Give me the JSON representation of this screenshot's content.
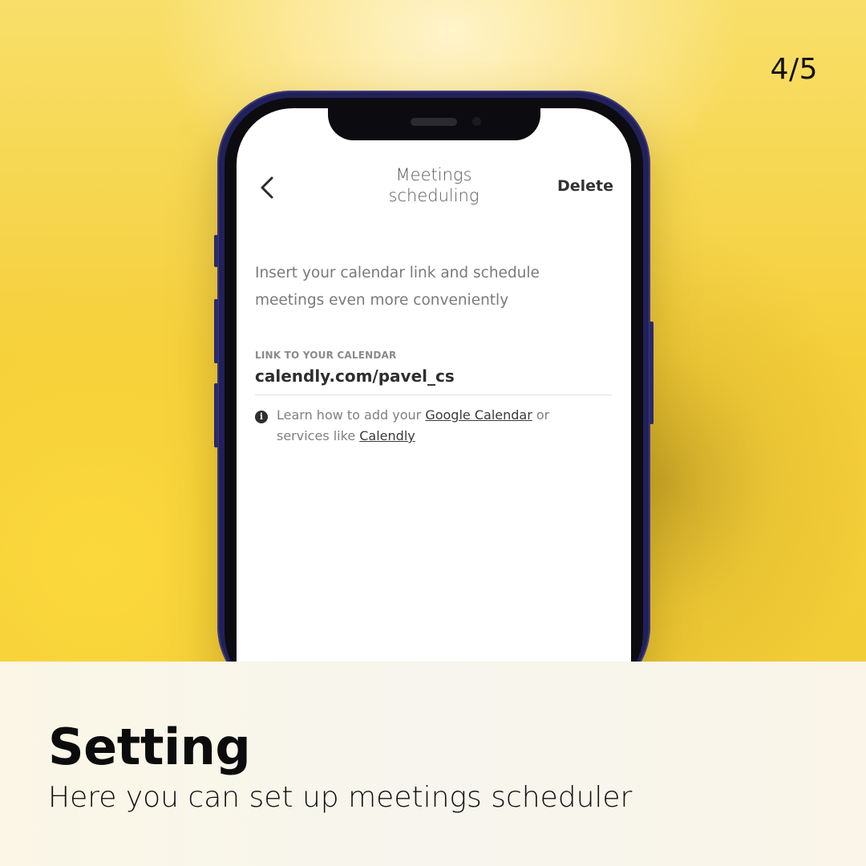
{
  "slide": {
    "counter": "4/5"
  },
  "app": {
    "nav": {
      "back_icon": "chevron-left-icon",
      "title": "Meetings scheduling",
      "delete_label": "Delete"
    },
    "intro_text": "Insert your calendar link and schedule meetings even more conveniently",
    "calendar_field": {
      "label": "LINK TO YOUR CALENDAR",
      "value": "calendly.com/pavel_cs"
    },
    "help": {
      "icon": "info-icon",
      "text_before": "Learn how to add your ",
      "google_link": "Google Calendar",
      "text_middle": " or services like ",
      "calendly_link": "Calendly"
    }
  },
  "caption": {
    "title": "Setting",
    "subtitle": "Here you can set up meetings scheduler"
  },
  "colors": {
    "background_yellow": "#f5cf3a",
    "phone_frame": "#22205a",
    "caption_bg": "#f7f5ee"
  }
}
